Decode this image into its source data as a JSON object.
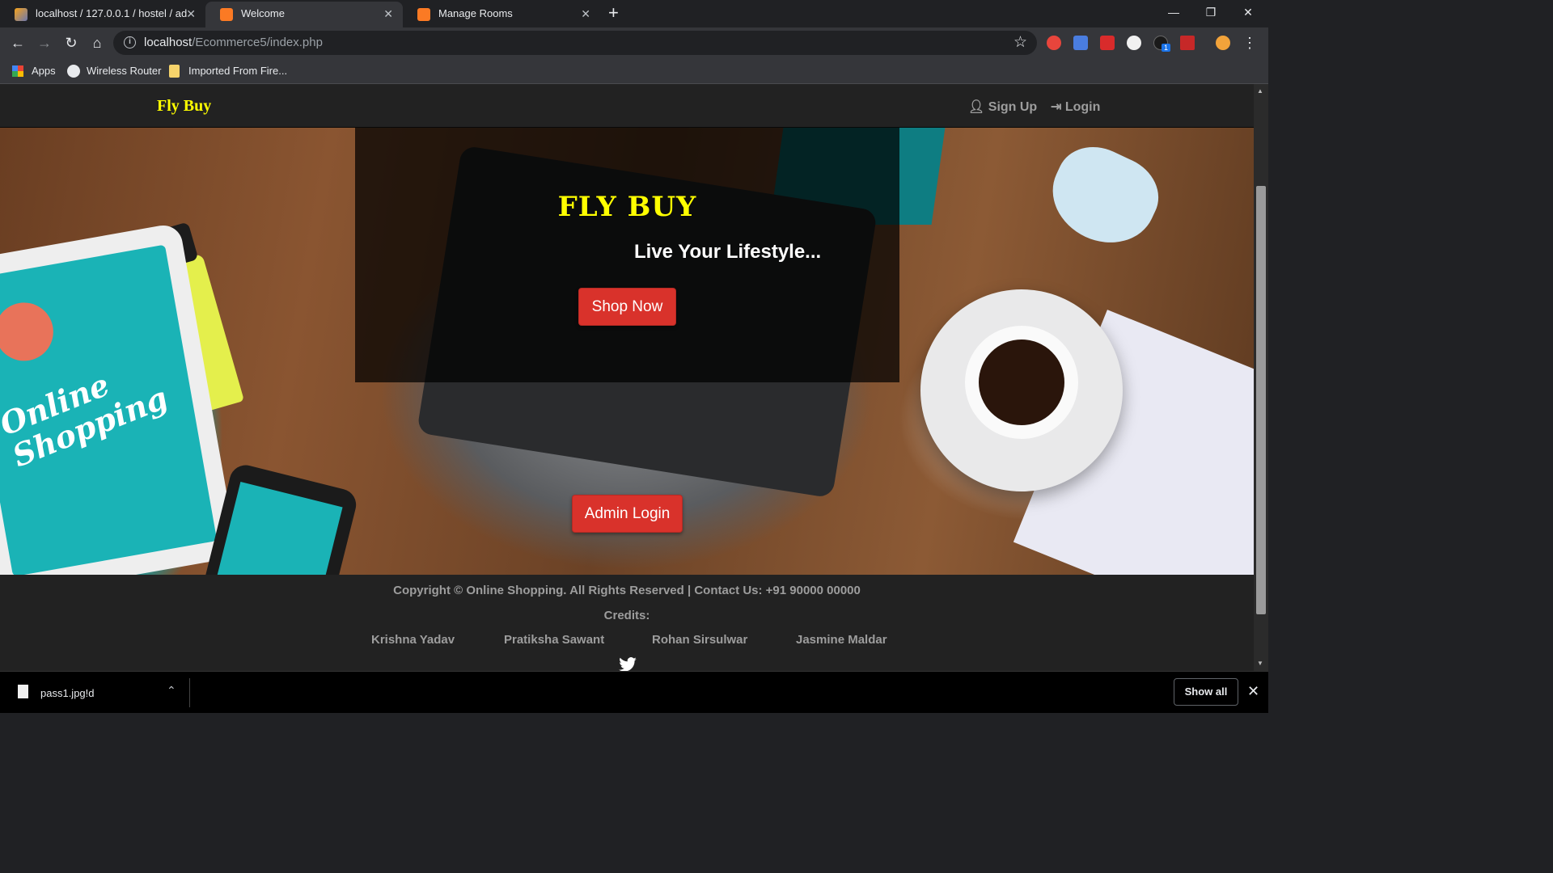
{
  "browser": {
    "tabs": [
      {
        "title": "localhost / 127.0.0.1 / hostel / ad",
        "favicon": "phpmyadmin-icon",
        "active": false
      },
      {
        "title": "Welcome",
        "favicon": "xampp-icon",
        "active": true
      },
      {
        "title": "Manage Rooms",
        "favicon": "xampp-icon",
        "active": false
      }
    ],
    "url_host": "localhost",
    "url_path": "/Ecommerce5/index.php",
    "bookmarks": [
      {
        "label": "Apps",
        "icon": "apps-grid-icon"
      },
      {
        "label": "Wireless Router",
        "icon": "globe-icon"
      },
      {
        "label": "Imported From Fire...",
        "icon": "folder-icon"
      }
    ],
    "extension_badge": "1"
  },
  "site": {
    "brand": "Fly Buy",
    "nav": {
      "signup": "Sign Up",
      "login": "Login"
    },
    "hero": {
      "title": "FLY BUY",
      "subtitle": "Live Your Lifestyle...",
      "shop_button": "Shop Now",
      "admin_button": "Admin Login",
      "image_text": "Online Shopping"
    },
    "footer": {
      "copyright": "Copyright © Online Shopping. All Rights Reserved | Contact Us: +91 90000 00000",
      "credits_label": "Credits:",
      "credits": [
        "Krishna Yadav",
        "Pratiksha Sawant",
        "Rohan Sirsulwar",
        "Jasmine Maldar"
      ]
    }
  },
  "downloads": {
    "file": "pass1.jpg!d",
    "show_all": "Show all"
  },
  "colors": {
    "brand": "#ffff00",
    "button": "#d9322b",
    "navbar": "#222222"
  }
}
